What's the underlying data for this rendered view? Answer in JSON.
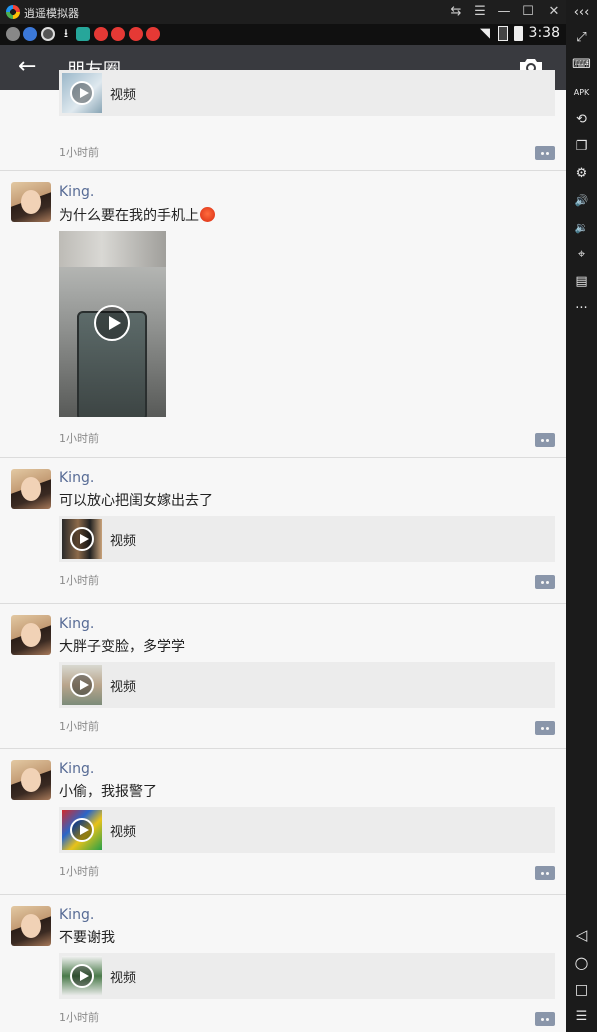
{
  "emulator": {
    "title": "逍遥模拟器",
    "controls": [
      "⇆",
      "☰",
      "—",
      "☐",
      "✕"
    ],
    "sidebar_icons": [
      "collapse-icon",
      "fullscreen-icon",
      "keyboard-icon",
      "apk-icon",
      "rotate-icon",
      "multi-window-icon",
      "settings-icon",
      "volume-up-icon",
      "volume-down-icon",
      "location-icon",
      "folder-icon",
      "more-icon",
      "back-nav-icon",
      "home-nav-icon",
      "recents-nav-icon",
      "menu-nav-icon"
    ],
    "sidebar_glyphs": [
      "‹‹‹",
      "⤢",
      "⌨",
      "APK",
      "⟲",
      "❐",
      "⚙",
      "🔊",
      "🔉",
      "⌖",
      "▤",
      "···",
      "◁",
      "○",
      "□",
      "☰"
    ]
  },
  "status_bar": {
    "time": "3:38",
    "notification_colors": [
      "#888888",
      "#3b78d8",
      "#dddddd",
      "#ffffff",
      "#26a69a",
      "#e53935",
      "#e53935",
      "#e53935",
      "#e53935"
    ]
  },
  "app_bar": {
    "back_glyph": "←",
    "title": "朋友圈",
    "camera_icon": "camera-icon"
  },
  "feed": {
    "top_partial": {
      "video_label": "视频",
      "time": "1小时前"
    },
    "posts": [
      {
        "author": "King.",
        "text": "为什么要在我的手机上",
        "has_emoji": true,
        "media": "large-video",
        "time": "1小时前"
      },
      {
        "author": "King.",
        "text": "可以放心把闺女嫁出去了",
        "media": "video",
        "video_label": "视频",
        "time": "1小时前"
      },
      {
        "author": "King.",
        "text": "大胖子变脸，多学学",
        "media": "video",
        "video_label": "视频",
        "time": "1小时前"
      },
      {
        "author": "King.",
        "text": "小偷，我报警了",
        "media": "video",
        "video_label": "视频",
        "time": "1小时前"
      },
      {
        "author": "King.",
        "text": "不要谢我",
        "media": "video",
        "video_label": "视频",
        "time": "1小时前"
      }
    ]
  },
  "colors": {
    "app_bar": "#393a3f",
    "author_name": "#576b95",
    "feed_background": "#f7f7f7",
    "comment_button": "#8a96aa"
  }
}
